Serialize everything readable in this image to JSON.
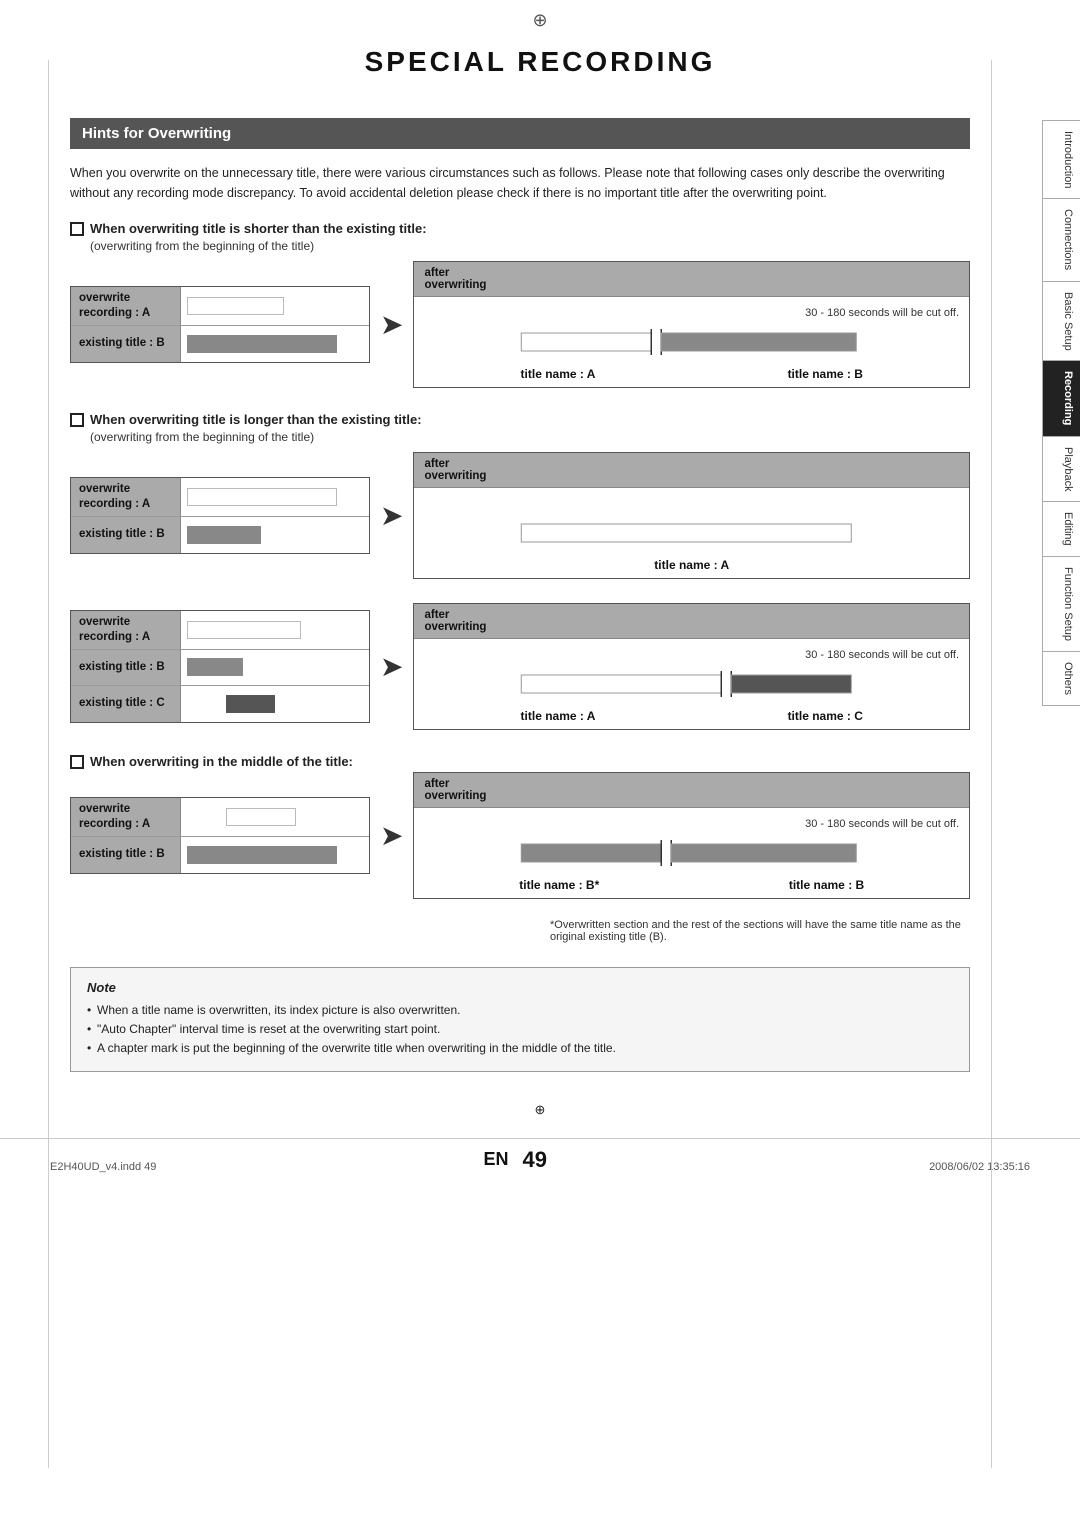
{
  "page": {
    "reg_mark": "⊕",
    "title": "SPECIAL RECORDING",
    "footer_left": "E2H40UD_v4.indd  49",
    "footer_right": "2008/06/02   13:35:16",
    "en_label": "EN",
    "page_number": "49"
  },
  "side_tabs": [
    {
      "label": "Introduction",
      "active": false
    },
    {
      "label": "Connections",
      "active": false
    },
    {
      "label": "Basic Setup",
      "active": false
    },
    {
      "label": "Recording",
      "active": true
    },
    {
      "label": "Playback",
      "active": false
    },
    {
      "label": "Editing",
      "active": false
    },
    {
      "label": "Function Setup",
      "active": false
    },
    {
      "label": "Others",
      "active": false
    }
  ],
  "section": {
    "header": "Hints for Overwriting",
    "intro": "When you overwrite on the unnecessary title, there were various circumstances such as follows.  Please note that following cases only describe the overwriting without any recording mode discrepancy.  To avoid accidental deletion please check if there is no important title after the overwriting point."
  },
  "subsections": [
    {
      "id": "shorter",
      "title": "When overwriting title is shorter than the existing title:",
      "subtitle": "(overwriting from the beginning of the title)",
      "left_rows": [
        {
          "label": "overwrite\nrecording : A",
          "bar_type": "white_short"
        },
        {
          "label": "existing title : B",
          "bar_type": "gray_full"
        }
      ],
      "right_header": "after\noverwriting",
      "right_note": "30 - 180 seconds will be cut off.",
      "right_bars": [
        {
          "type": "combined_ab"
        }
      ],
      "title_labels": [
        "title name : A",
        "title name : B"
      ]
    },
    {
      "id": "longer",
      "title": "When overwriting title is longer than the existing title:",
      "subtitle": "(overwriting from the beginning of the title)",
      "left_rows": [
        {
          "label": "overwrite\nrecording : A",
          "bar_type": "white_full"
        },
        {
          "label": "existing title : B",
          "bar_type": "gray_short"
        }
      ],
      "right_header": "after\noverwriting",
      "right_note": null,
      "right_bars": [
        {
          "type": "single_a"
        }
      ],
      "title_labels": [
        "title name : A"
      ]
    },
    {
      "id": "longer2",
      "title": null,
      "subtitle": null,
      "left_rows": [
        {
          "label": "overwrite\nrecording : A",
          "bar_type": "white_med"
        },
        {
          "label": "existing title : B",
          "bar_type": "gray_short2"
        },
        {
          "label": "existing title : C",
          "bar_type": "gray_short3"
        }
      ],
      "right_header": "after\noverwriting",
      "right_note": "30 - 180 seconds will be cut off.",
      "right_bars": [
        {
          "type": "combined_ac"
        }
      ],
      "title_labels": [
        "title name : A",
        "title name : C"
      ]
    },
    {
      "id": "middle",
      "title": "When overwriting in the middle of the title:",
      "subtitle": null,
      "left_rows": [
        {
          "label": "overwrite\nrecording : A",
          "bar_type": "white_center"
        },
        {
          "label": "existing title : B",
          "bar_type": "gray_full2"
        }
      ],
      "right_header": "after\noverwriting",
      "right_note": "30 - 180 seconds will be cut off.",
      "right_bars": [
        {
          "type": "split_b"
        }
      ],
      "title_labels": [
        "title name : B*",
        "title name : B"
      ],
      "footnote": "*Overwritten section and the rest of the sections will have the same title name as the original existing title (B)."
    }
  ],
  "note": {
    "title": "Note",
    "items": [
      "When a title name is overwritten, its index picture is also overwritten.",
      "\"Auto Chapter\" interval time is reset at the overwriting start point.",
      "A chapter mark is put the beginning of the overwrite title when overwriting in the middle of the title."
    ]
  }
}
